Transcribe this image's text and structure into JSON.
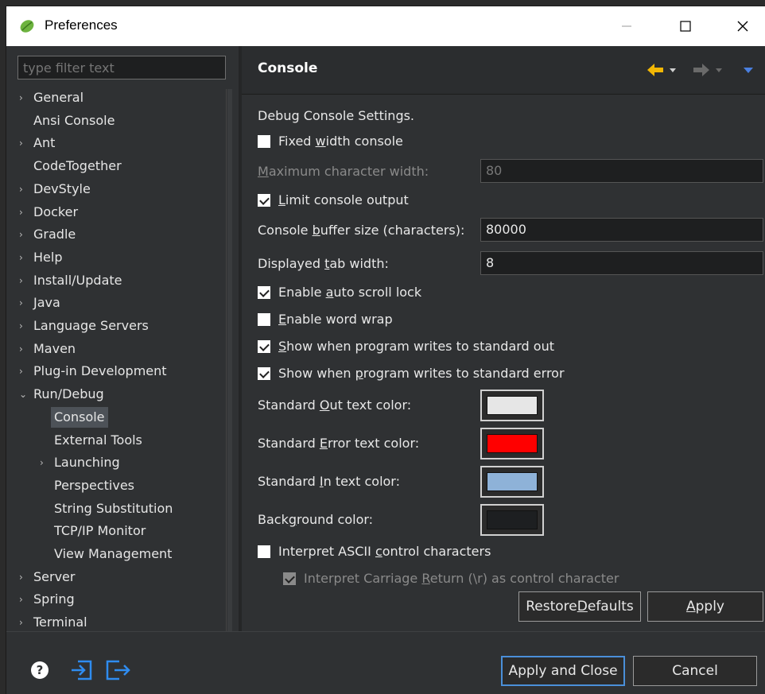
{
  "window": {
    "title": "Preferences"
  },
  "filter": {
    "placeholder": "type filter text"
  },
  "tree": [
    {
      "label": "General",
      "chevron": "›",
      "level": 0
    },
    {
      "label": "Ansi Console",
      "chevron": "",
      "level": 0
    },
    {
      "label": "Ant",
      "chevron": "›",
      "level": 0
    },
    {
      "label": "CodeTogether",
      "chevron": "",
      "level": 0
    },
    {
      "label": "DevStyle",
      "chevron": "›",
      "level": 0
    },
    {
      "label": "Docker",
      "chevron": "›",
      "level": 0
    },
    {
      "label": "Gradle",
      "chevron": "›",
      "level": 0
    },
    {
      "label": "Help",
      "chevron": "›",
      "level": 0
    },
    {
      "label": "Install/Update",
      "chevron": "›",
      "level": 0
    },
    {
      "label": "Java",
      "chevron": "›",
      "level": 0
    },
    {
      "label": "Language Servers",
      "chevron": "›",
      "level": 0
    },
    {
      "label": "Maven",
      "chevron": "›",
      "level": 0
    },
    {
      "label": "Plug-in Development",
      "chevron": "›",
      "level": 0
    },
    {
      "label": "Run/Debug",
      "chevron": "⌄",
      "level": 0
    },
    {
      "label": "Console",
      "chevron": "",
      "level": 1,
      "selected": true
    },
    {
      "label": "External Tools",
      "chevron": "",
      "level": 1
    },
    {
      "label": "Launching",
      "chevron": "›",
      "level": 1
    },
    {
      "label": "Perspectives",
      "chevron": "",
      "level": 1
    },
    {
      "label": "String Substitution",
      "chevron": "",
      "level": 1
    },
    {
      "label": "TCP/IP Monitor",
      "chevron": "",
      "level": 1
    },
    {
      "label": "View Management",
      "chevron": "",
      "level": 1
    },
    {
      "label": "Server",
      "chevron": "›",
      "level": 0
    },
    {
      "label": "Spring",
      "chevron": "›",
      "level": 0
    },
    {
      "label": "Terminal",
      "chevron": "›",
      "level": 0
    }
  ],
  "page": {
    "title": "Console",
    "section": "Debug Console Settings.",
    "fixed_width": {
      "pre": "Fixed ",
      "key": "w",
      "post": "idth console",
      "checked": false
    },
    "max_width": {
      "pre": "",
      "key": "M",
      "post": "aximum character width:",
      "value": "80"
    },
    "limit_output": {
      "pre": "",
      "key": "L",
      "post": "imit console output",
      "checked": true
    },
    "buffer_size": {
      "pre": "Console ",
      "key": "b",
      "post": "uffer size (characters):",
      "value": "80000"
    },
    "tab_width": {
      "pre": "Displayed ",
      "key": "t",
      "post": "ab width:",
      "value": "8"
    },
    "auto_scroll": {
      "pre": "Enable ",
      "key": "a",
      "post": "uto scroll lock",
      "checked": true
    },
    "word_wrap": {
      "pre": "",
      "key": "E",
      "post": "nable word wrap",
      "checked": false
    },
    "show_out": {
      "pre": "",
      "key": "S",
      "post": "how when program writes to standard out",
      "checked": true
    },
    "show_err": {
      "pre": "Show when ",
      "key": "p",
      "post": "rogram writes to standard error",
      "checked": true
    },
    "std_out_color": {
      "pre": "Standard ",
      "key": "O",
      "post": "ut text color:",
      "color": "#e6e6e6"
    },
    "std_err_color": {
      "pre": "Standard ",
      "key": "E",
      "post": "rror text color:",
      "color": "#ff0000"
    },
    "std_in_color": {
      "pre": "Standard ",
      "key": "I",
      "post": "n text color:",
      "color": "#8eb2d8"
    },
    "bg_color": {
      "pre": "Back",
      "key": "g",
      "post": "round color:",
      "color": "#1d1f21"
    },
    "ascii": {
      "pre": "Interpret ASCII ",
      "key": "c",
      "post": "ontrol characters",
      "checked": false
    },
    "carriage": {
      "pre": "Interpret Carriage ",
      "key": "R",
      "post": "eturn (\\r) as control character",
      "checked": true
    },
    "restore_defaults": {
      "pre": "Restore ",
      "key": "D",
      "post": "efaults"
    },
    "apply": {
      "pre": "",
      "key": "A",
      "post": "pply"
    }
  },
  "footer": {
    "apply_close": "Apply and Close",
    "cancel": "Cancel"
  },
  "colors": {
    "accent": "#4a8fd9",
    "nav_back": "#f2b705"
  }
}
